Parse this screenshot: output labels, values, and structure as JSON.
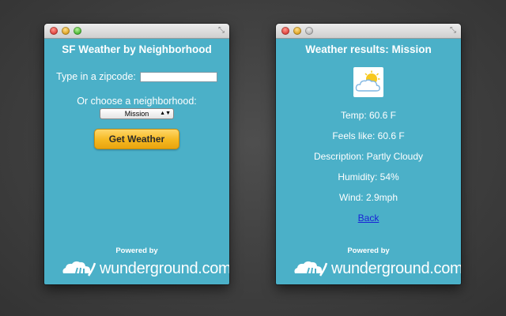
{
  "left_window": {
    "title": "SF Weather by Neighborhood",
    "zip_label": "Type in a zipcode:",
    "zip_value": "",
    "choose_label": "Or choose a neighborhood:",
    "neighborhood_selected": "Mission",
    "get_weather_button": "Get Weather",
    "powered_by": "Powered by",
    "brand_name": "wunderground.com",
    "brand_reg": "®"
  },
  "right_window": {
    "title": "Weather results: Mission",
    "weather_icon": "partly-cloudy-icon",
    "temp": "Temp: 60.6 F",
    "feels_like": "Feels like: 60.6 F",
    "description": "Description: Partly Cloudy",
    "humidity": "Humidity: 54%",
    "wind": "Wind: 2.9mph",
    "back_link": "Back",
    "powered_by": "Powered by",
    "brand_name": "wunderground.com",
    "brand_reg": "®"
  },
  "colors": {
    "panel_bg": "#4bb0c8",
    "button_bg": "#f5b820",
    "link": "#1a24d6"
  }
}
